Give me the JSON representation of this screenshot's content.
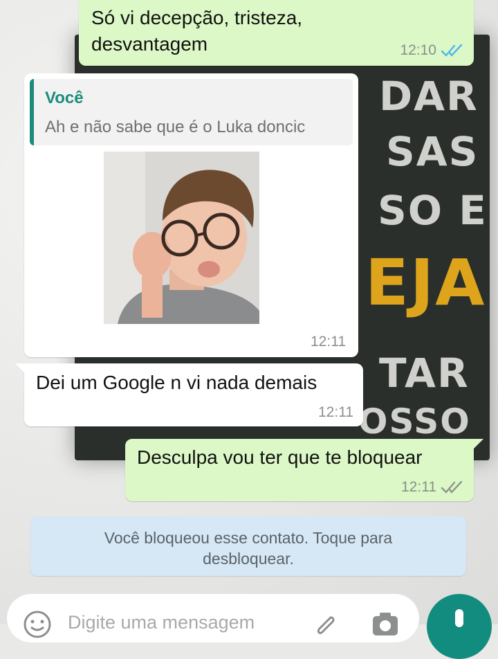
{
  "messages": [
    {
      "dir": "out",
      "text_line1": "Só vi decepção, tristeza,",
      "text_line2": "desvantagem",
      "time": "12:10",
      "status": "read"
    },
    {
      "dir": "in",
      "quote_author": "Você",
      "quote_text": "Ah e não sabe que é o Luka doncic",
      "has_image": true,
      "time": "12:11"
    },
    {
      "dir": "in",
      "text": "Dei um Google n vi nada demais",
      "time": "12:11"
    },
    {
      "dir": "out",
      "text": "Desculpa vou ter que te bloquear",
      "time": "12:11",
      "status": "delivered"
    }
  ],
  "system_notice": {
    "line1": "Você bloqueou esse contato. Toque para",
    "line2": "desbloquear."
  },
  "composer": {
    "placeholder": "Digite uma mensagem"
  },
  "wallpaper_words": [
    "DAR",
    "SAS",
    "SO E",
    "EJA",
    "TAR",
    "OSSO"
  ],
  "colors": {
    "outgoing": "#dcf8c6",
    "incoming": "#ffffff",
    "accent": "#128c7e",
    "read_tick": "#4fb6ec",
    "quote_author": "#1d8b7b"
  },
  "icons": {
    "emoji": "emoji-icon",
    "attach": "paperclip-icon",
    "camera": "camera-icon",
    "mic": "mic-icon",
    "read": "double-check-icon"
  }
}
